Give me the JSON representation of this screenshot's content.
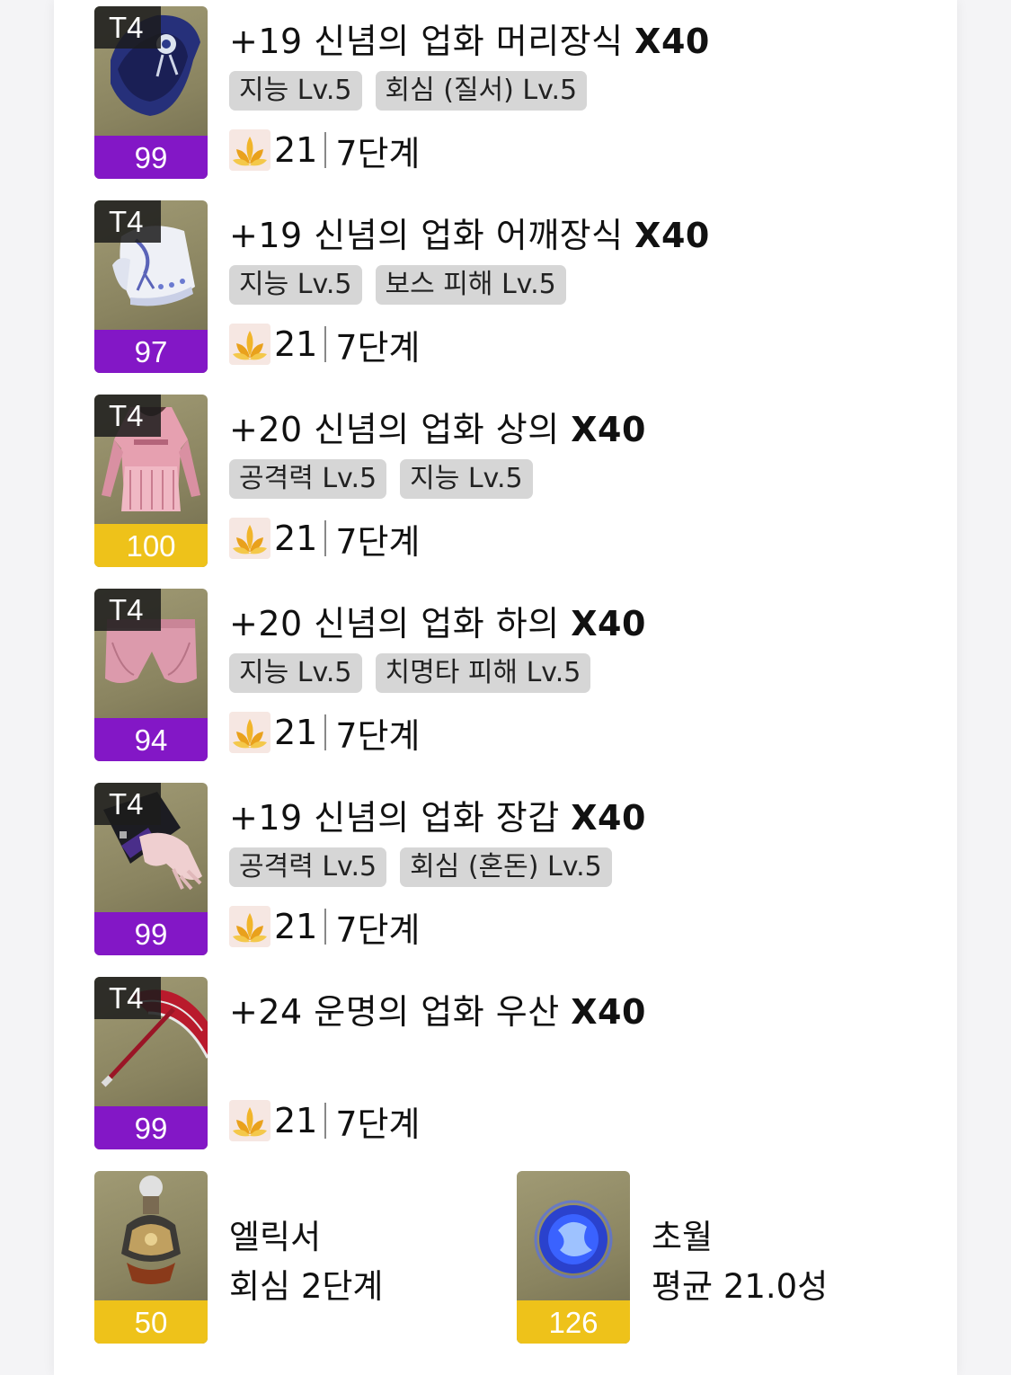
{
  "equipment": [
    {
      "tier": "T4",
      "quality": "99",
      "quality_color": "#8317c6",
      "item_icon": "hat-icon",
      "name": "+19 신념의 업화 머리장식",
      "count": "X40",
      "tags": [
        "지능 Lv.5",
        "회심 (질서) Lv.5"
      ],
      "stone_icon": "lotus-icon",
      "stone": "21",
      "stage": "7단계"
    },
    {
      "tier": "T4",
      "quality": "97",
      "quality_color": "#8317c6",
      "item_icon": "shoulder-icon",
      "name": "+19 신념의 업화 어깨장식",
      "count": "X40",
      "tags": [
        "지능 Lv.5",
        "보스 피해 Lv.5"
      ],
      "stone_icon": "lotus-icon",
      "stone": "21",
      "stage": "7단계"
    },
    {
      "tier": "T4",
      "quality": "100",
      "quality_color": "#eec21a",
      "item_icon": "top-icon",
      "name": "+20 신념의 업화 상의",
      "count": "X40",
      "tags": [
        "공격력 Lv.5",
        "지능 Lv.5"
      ],
      "stone_icon": "lotus-icon",
      "stone": "21",
      "stage": "7단계"
    },
    {
      "tier": "T4",
      "quality": "94",
      "quality_color": "#8317c6",
      "item_icon": "pants-icon",
      "name": "+20 신념의 업화 하의",
      "count": "X40",
      "tags": [
        "지능 Lv.5",
        "치명타 피해 Lv.5"
      ],
      "stone_icon": "lotus-icon",
      "stone": "21",
      "stage": "7단계"
    },
    {
      "tier": "T4",
      "quality": "99",
      "quality_color": "#8317c6",
      "item_icon": "glove-icon",
      "name": "+19 신념의 업화 장갑",
      "count": "X40",
      "tags": [
        "공격력 Lv.5",
        "회심 (혼돈) Lv.5"
      ],
      "stone_icon": "lotus-icon",
      "stone": "21",
      "stage": "7단계"
    },
    {
      "tier": "T4",
      "quality": "99",
      "quality_color": "#8317c6",
      "item_icon": "umbrella-icon",
      "name": "+24 운명의 업화 우산",
      "count": "X40",
      "tags": [],
      "stone_icon": "lotus-icon",
      "stone": "21",
      "stage": "7단계"
    }
  ],
  "extras": [
    {
      "quality": "50",
      "quality_color": "#eec21a",
      "item_icon": "elixir-bottle-icon",
      "line1": "엘릭서",
      "line2": "회심 2단계"
    },
    {
      "quality": "126",
      "quality_color": "#eec21a",
      "item_icon": "transcend-orb-icon",
      "line1": "초월",
      "line2": "평균 21.0성"
    }
  ]
}
